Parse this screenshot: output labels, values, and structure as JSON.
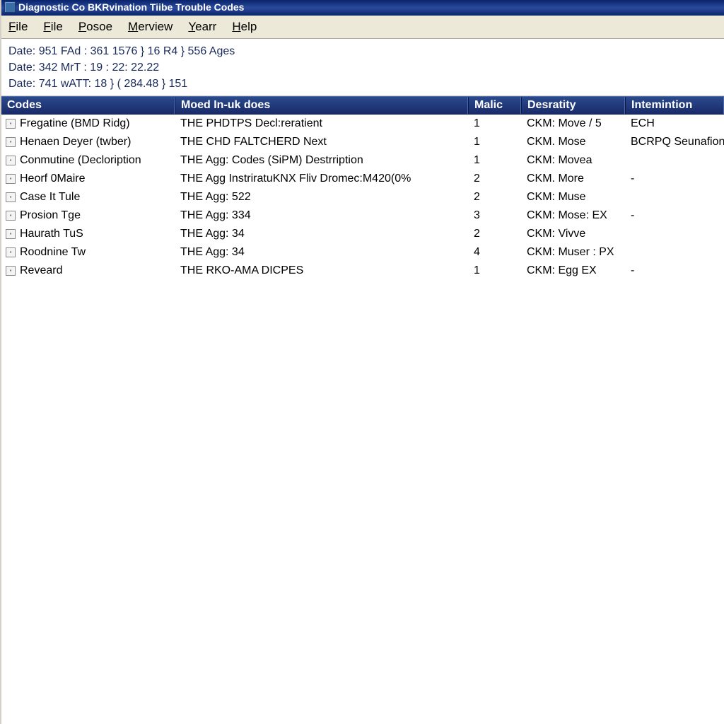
{
  "titlebar": {
    "title": "Diagnostic Co BKRvination Tiibe Trouble Codes"
  },
  "menubar": {
    "items": [
      {
        "label": "File",
        "key": "F"
      },
      {
        "label": "File",
        "key": "F"
      },
      {
        "label": "Posoe",
        "key": "P"
      },
      {
        "label": "Merview",
        "key": "M"
      },
      {
        "label": "Yearr",
        "key": "Y"
      },
      {
        "label": "Help",
        "key": "H"
      }
    ]
  },
  "info": {
    "lines": [
      "Date: 951 FAd : 361 1576 } 16 R4 } 556 Ages",
      "Date: 342 MrT : 19 : 22: 22.22",
      "Date: 741 wATT: 18 } ( 284.48 } 151"
    ]
  },
  "table": {
    "headers": {
      "codes": "Codes",
      "moed": "Moed In-uk does",
      "malic": "Malic",
      "desr": "Desratity",
      "intem": "Intemintion"
    },
    "rows": [
      {
        "codes": "Fregatine (BMD Ridg)",
        "moed": "THE PHDTPS Decl:reratient",
        "malic": "1",
        "desr": "CKM: Move / 5",
        "intem": "ECH"
      },
      {
        "codes": "Henaen Deyer (twber)",
        "moed": "THE CHD FALTCHERD Next",
        "malic": "1",
        "desr": "CKM. Mose",
        "intem": "BCRPQ Seunafion"
      },
      {
        "codes": "Conmutine (Decloription",
        "moed": "THE Agg: Codes (SiPM) Destrription",
        "malic": "1",
        "desr": "CKM: Movea",
        "intem": ""
      },
      {
        "codes": "Heorf 0Maire",
        "moed": "THE Agg InstriratuKNX Fliv Dromec:M420(0%",
        "malic": "2",
        "desr": "CKM. More",
        "intem": "-"
      },
      {
        "codes": "Case It Tule",
        "moed": "THE Agg: 522",
        "malic": "2",
        "desr": "CKM: Muse",
        "intem": ""
      },
      {
        "codes": "Prosion Tge",
        "moed": "THE Agg: 334",
        "malic": "3",
        "desr": "CKM: Mose: EX",
        "intem": "-"
      },
      {
        "codes": "Haurath TuS",
        "moed": "THE Agg: 34",
        "malic": "2",
        "desr": "CKM: Vivve",
        "intem": ""
      },
      {
        "codes": "Roodnine Tw",
        "moed": "THE Agg: 34",
        "malic": "4",
        "desr": "CKM: Muser : PX",
        "intem": ""
      },
      {
        "codes": "Reveard",
        "moed": "THE RKO-AMA DICPES",
        "malic": "1",
        "desr": "CKM: Egg EX",
        "intem": "-"
      }
    ]
  }
}
